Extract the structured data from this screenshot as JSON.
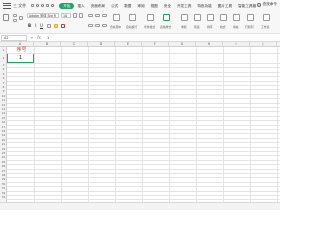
{
  "menu": {
    "file_label": "三 文件",
    "tabs": [
      {
        "label": "开始",
        "active": true
      },
      {
        "label": "插入"
      },
      {
        "label": "页面布局"
      },
      {
        "label": "公式"
      },
      {
        "label": "数据"
      },
      {
        "label": "审阅"
      },
      {
        "label": "视图"
      },
      {
        "label": "安全"
      },
      {
        "label": "开发工具"
      },
      {
        "label": "特色功能"
      },
      {
        "label": "图片工具"
      },
      {
        "label": "智能工具箱"
      }
    ],
    "search_label": "查找命令"
  },
  "toolbar": {
    "font_name": "Adobe 宋体 Std R",
    "font_size": "18",
    "bold": "B",
    "italic": "I",
    "underline": "U",
    "labels": {
      "wrap": "合并居中",
      "auto_wrap": "自动换行",
      "format_cond": "条件格式",
      "table_style": "表格样式",
      "sum": "求和",
      "filter": "筛选",
      "sort": "排序",
      "format": "格式",
      "fill": "填充",
      "row_col": "行和列",
      "worksheet": "工作表"
    }
  },
  "formula_bar": {
    "cell_ref": "A2",
    "fx_icon": "fx",
    "value": "1"
  },
  "grid": {
    "columns": [
      "A",
      "B",
      "C",
      "D",
      "E",
      "F",
      "G",
      "H",
      "I",
      "J"
    ],
    "rows": [
      "1",
      "2",
      "3",
      "4",
      "5",
      "6",
      "7",
      "8",
      "9",
      "10",
      "11",
      "12",
      "13",
      "14",
      "15",
      "16",
      "17",
      "18",
      "19",
      "20",
      "21",
      "22",
      "23",
      "24",
      "25",
      "26",
      "27",
      "28",
      "29",
      "30",
      "31",
      "32",
      "33",
      "34",
      "35"
    ],
    "cells": {
      "A1": "序号",
      "A2": "1"
    },
    "colors": {
      "header_text": "#c0392b",
      "selection": "#21a366"
    }
  }
}
